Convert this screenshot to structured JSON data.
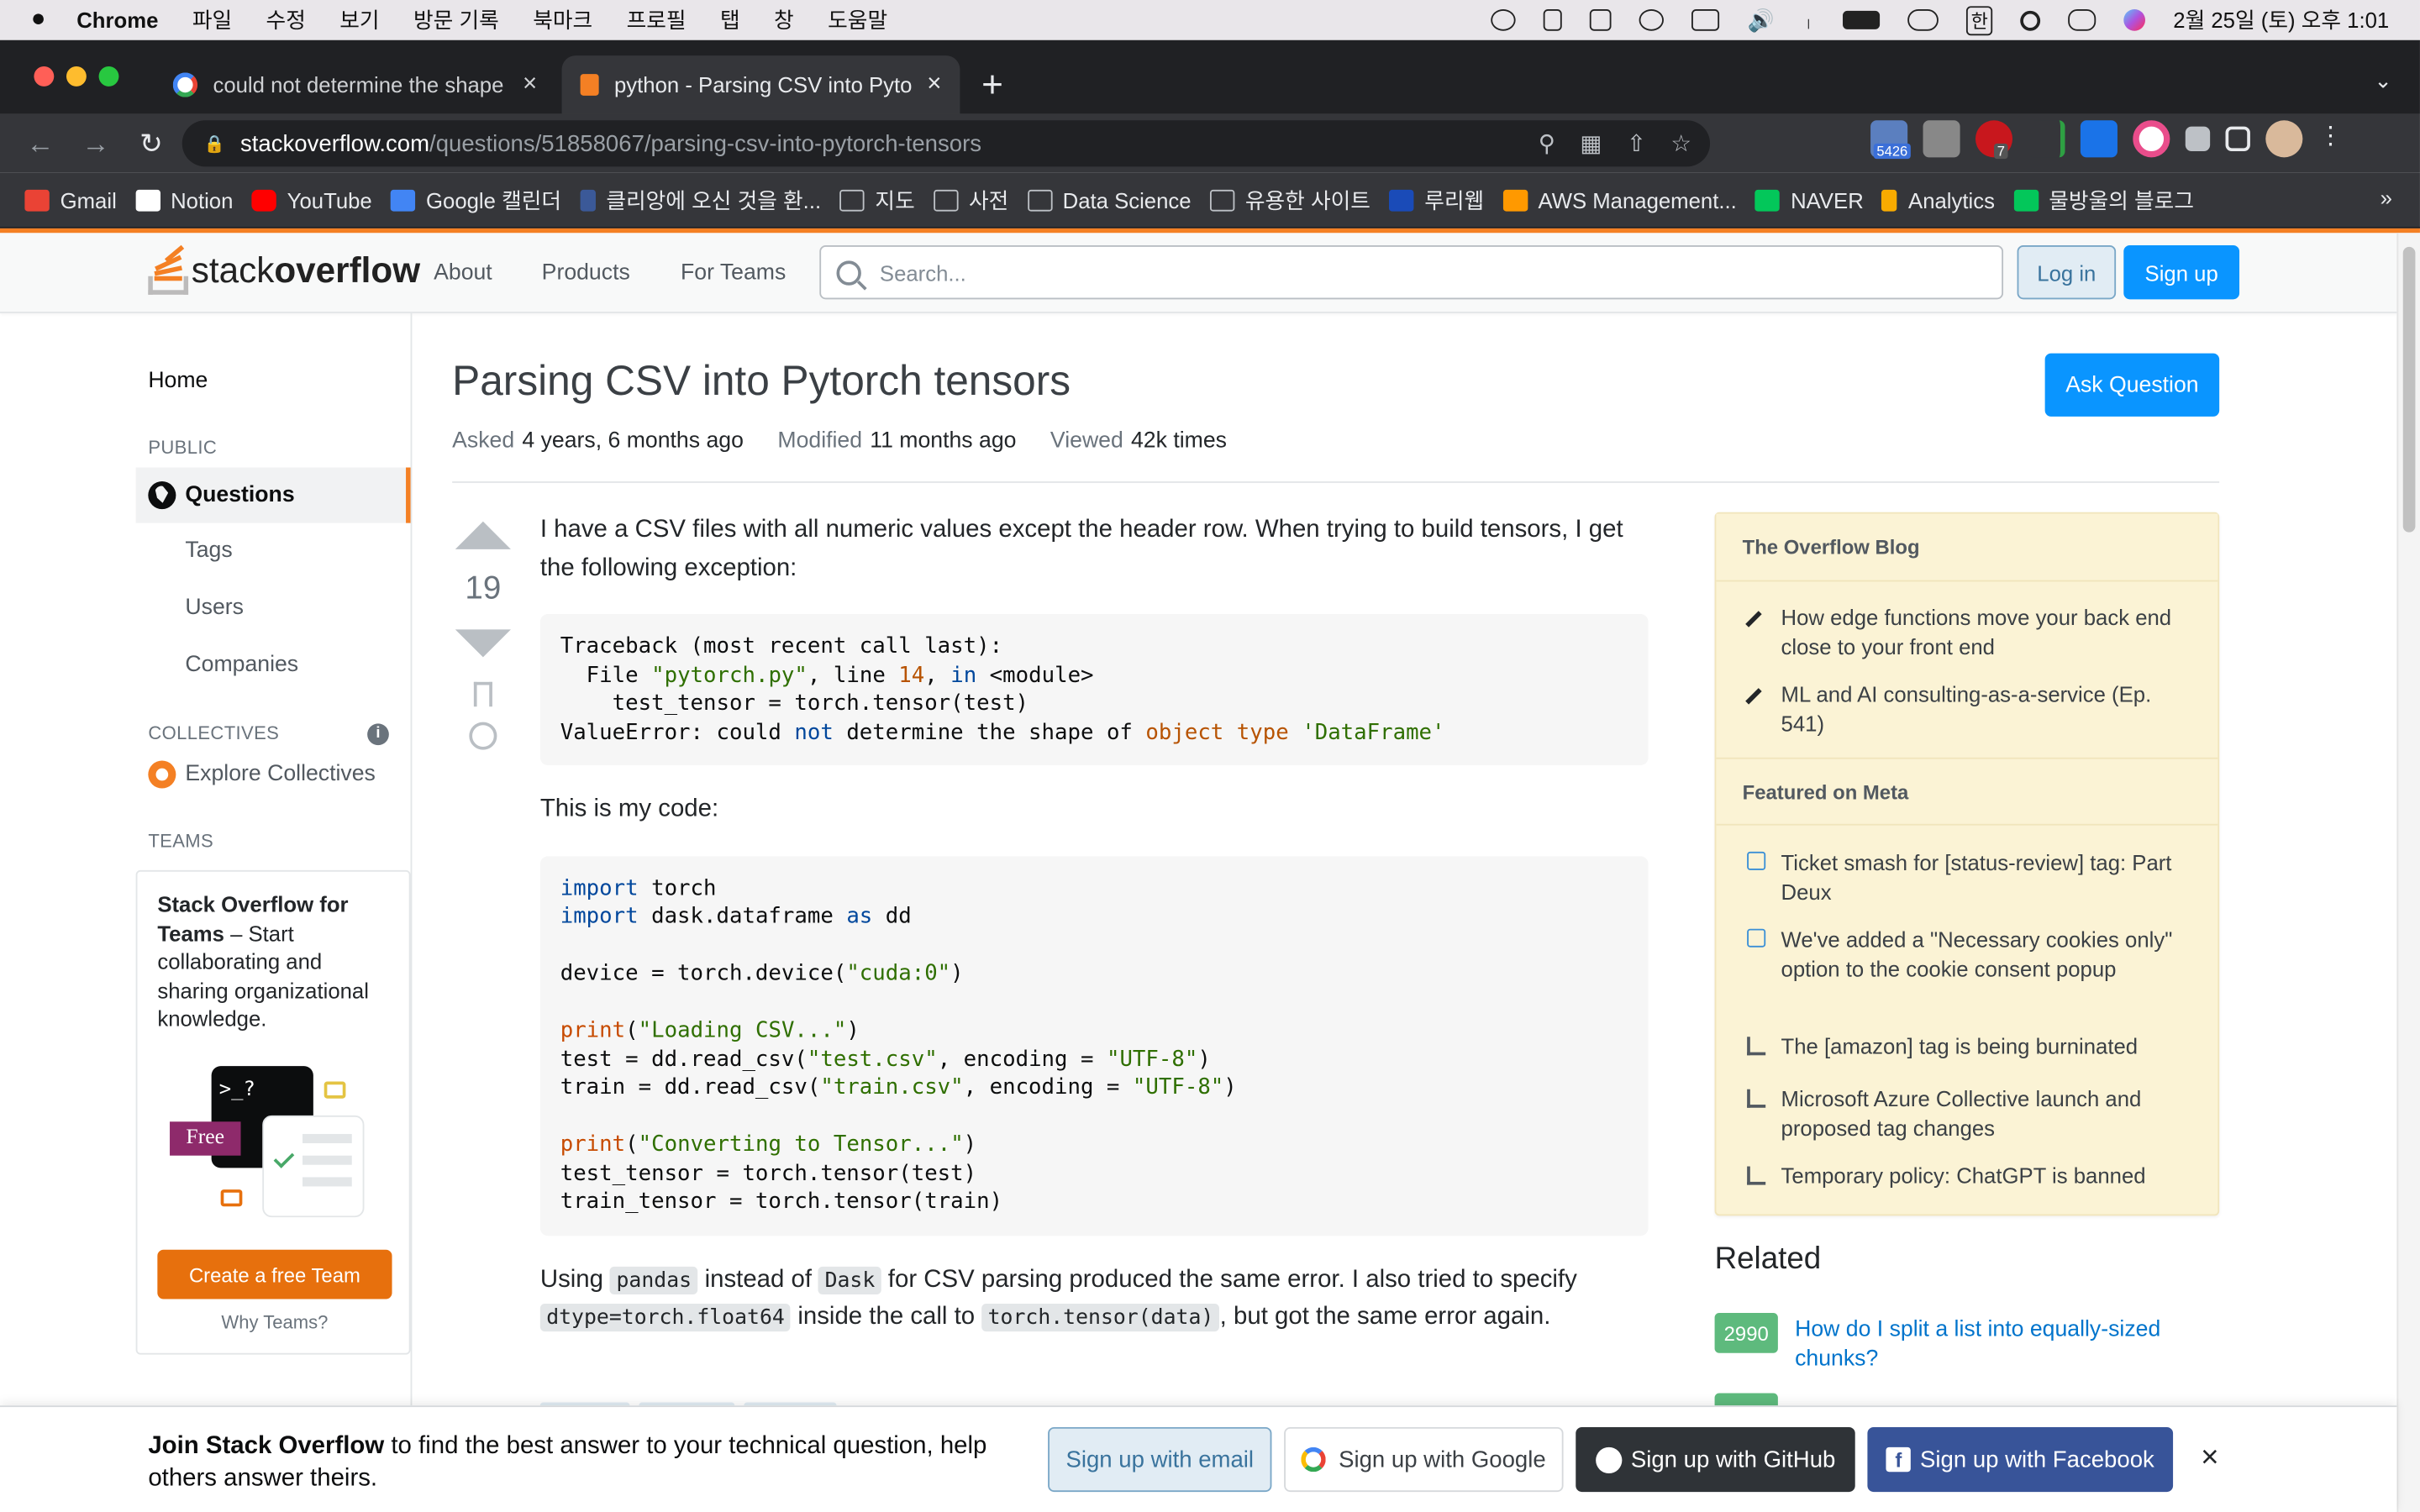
{
  "macos": {
    "apple": "",
    "app": "Chrome",
    "menus": [
      "파일",
      "수정",
      "보기",
      "방문 기록",
      "북마크",
      "프로필",
      "탭",
      "창",
      "도움말"
    ],
    "ime": "한",
    "datetime": "2월 25일 (토) 오후 1:01"
  },
  "tabs": [
    {
      "label": "could not determine the shape",
      "close": "×"
    },
    {
      "label": "python - Parsing CSV into Pyto",
      "close": "×"
    }
  ],
  "new_tab": "+",
  "address": {
    "host": "stackoverflow.com",
    "path": "/questions/51858067/parsing-csv-into-pytorch-tensors"
  },
  "extensions": {
    "badge_count": "5426",
    "abp_count": "7"
  },
  "bookmarks": [
    {
      "label": "Gmail",
      "color": "#ea4335"
    },
    {
      "label": "Notion",
      "color": "#ffffff"
    },
    {
      "label": "YouTube",
      "color": "#ff0000"
    },
    {
      "label": "Google 캘린더",
      "color": "#4285f4"
    },
    {
      "label": "클리앙에 오신 것을 환...",
      "color": "#3b5998"
    },
    {
      "label": "지도",
      "color": "folder"
    },
    {
      "label": "사전",
      "color": "folder"
    },
    {
      "label": "Data Science",
      "color": "folder"
    },
    {
      "label": "유용한 사이트",
      "color": "folder"
    },
    {
      "label": "루리웹",
      "color": "#1a4bb8"
    },
    {
      "label": "AWS Management...",
      "color": "#ff9900"
    },
    {
      "label": "NAVER",
      "color": "#03c75a"
    },
    {
      "label": "Analytics",
      "color": "#f9ab00"
    },
    {
      "label": "물방울의 블로그",
      "color": "#03c75a"
    }
  ],
  "bookmarks_more": "»",
  "so": {
    "logo_light": "stack",
    "logo_bold": "overflow",
    "nav": [
      "About",
      "Products",
      "For Teams"
    ],
    "search_placeholder": "Search...",
    "login": "Log in",
    "signup": "Sign up"
  },
  "leftnav": {
    "home": "Home",
    "public": "PUBLIC",
    "questions": "Questions",
    "tags": "Tags",
    "users": "Users",
    "companies": "Companies",
    "collectives": "COLLECTIVES",
    "info": "i",
    "explore": "Explore Collectives",
    "teams_label": "TEAMS",
    "teams_title": "Stack Overflow for Teams",
    "teams_desc": " – Start collaborating and sharing organizational knowledge.",
    "free": "Free",
    "prompt": ">_?",
    "create_team": "Create a free Team",
    "why_teams": "Why Teams?"
  },
  "question": {
    "title": "Parsing CSV into Pytorch tensors",
    "ask_button": "Ask Question",
    "asked_label": "Asked",
    "asked_value": "4 years, 6 months ago",
    "modified_label": "Modified",
    "modified_value": "11 months ago",
    "viewed_label": "Viewed",
    "viewed_value": "42k times",
    "score": "19",
    "para1": "I have a CSV files with all numeric values except the header row. When trying to build tensors, I get the following exception:",
    "para2": "This is my code:",
    "para3_a": "Using ",
    "para3_pandas": "pandas",
    "para3_b": " instead of ",
    "para3_dask": "Dask",
    "para3_c": " for CSV parsing produced the same error. I also tried to specify ",
    "para3_dtype": "dtype=torch.float64",
    "para3_d": " inside the call to ",
    "para3_call": "torch.tensor(data)",
    "para3_e": ", but got the same error again."
  },
  "sidebar": {
    "blog_title": "The Overflow Blog",
    "blog_items": [
      "How edge functions move your back end close to your front end",
      "ML and AI consulting-as-a-service (Ep. 541)"
    ],
    "meta_title": "Featured on Meta",
    "meta_items": [
      "Ticket smash for [status-review] tag: Part Deux",
      "We've added a \"Necessary cookies only\" option to the cookie consent popup",
      "The [amazon] tag is being burninated",
      "Microsoft Azure Collective launch and proposed tag changes",
      "Temporary policy: ChatGPT is banned"
    ]
  },
  "related": {
    "title": "Related",
    "items": [
      {
        "score": "2990",
        "title": "How do I split a list into equally-sized chunks?"
      }
    ]
  },
  "banner": {
    "bold": "Join Stack Overflow",
    "rest": " to find the best answer to your technical question, help others answer theirs.",
    "email": "Sign up with email",
    "google": "Sign up with Google",
    "github": "Sign up with GitHub",
    "facebook": "Sign up with Facebook",
    "close": "×"
  },
  "colors": {
    "accent": "#f48024",
    "primary": "#0a95ff",
    "link": "#0074cc"
  }
}
